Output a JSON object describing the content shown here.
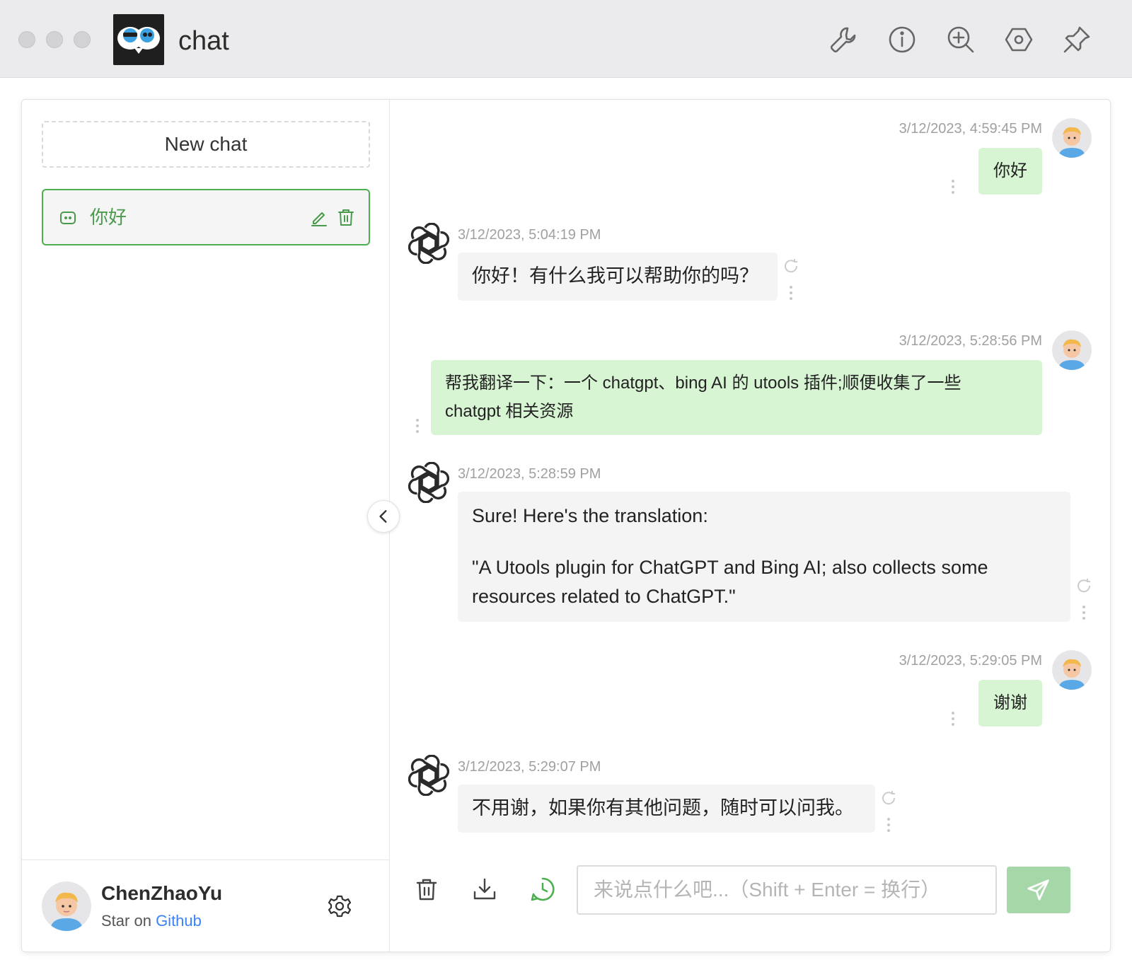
{
  "window": {
    "title": "chat"
  },
  "titlebar_icons": [
    "wrench-icon",
    "info-icon",
    "zoom-in-icon",
    "settings-hexagon-icon",
    "pin-icon"
  ],
  "sidebar": {
    "new_chat_label": "New chat",
    "chats": [
      {
        "label": "你好"
      }
    ],
    "user": {
      "name": "ChenZhaoYu",
      "star_prefix": "Star on",
      "github_label": "Github"
    }
  },
  "messages": [
    {
      "role": "user",
      "time": "3/12/2023, 4:59:45 PM",
      "text": "你好"
    },
    {
      "role": "assistant",
      "time": "3/12/2023, 5:04:19 PM",
      "text": "你好！有什么我可以帮助你的吗？"
    },
    {
      "role": "user",
      "time": "3/12/2023, 5:28:56 PM",
      "line1": "帮我翻译一下：一个 chatgpt、bing AI 的 utools 插件;顺便收集了一些",
      "line2": "chatgpt 相关资源"
    },
    {
      "role": "assistant",
      "time": "3/12/2023, 5:28:59 PM",
      "para1": "Sure! Here's the translation:",
      "para2_line1": "\"A Utools plugin for ChatGPT and Bing AI; also collects some",
      "para2_line2": "resources related to ChatGPT.\""
    },
    {
      "role": "user",
      "time": "3/12/2023, 5:29:05 PM",
      "text": "谢谢"
    },
    {
      "role": "assistant",
      "time": "3/12/2023, 5:29:07 PM",
      "text": "不用谢，如果你有其他问题，随时可以问我。"
    }
  ],
  "input": {
    "placeholder": "来说点什么吧...（Shift + Enter = 换行）",
    "value": ""
  },
  "colors": {
    "accent": "#4caf50",
    "user_bubble": "#d7f5d3",
    "bot_bubble": "#f4f4f5",
    "send_button": "#a6d7a8",
    "link": "#3b82f6"
  }
}
